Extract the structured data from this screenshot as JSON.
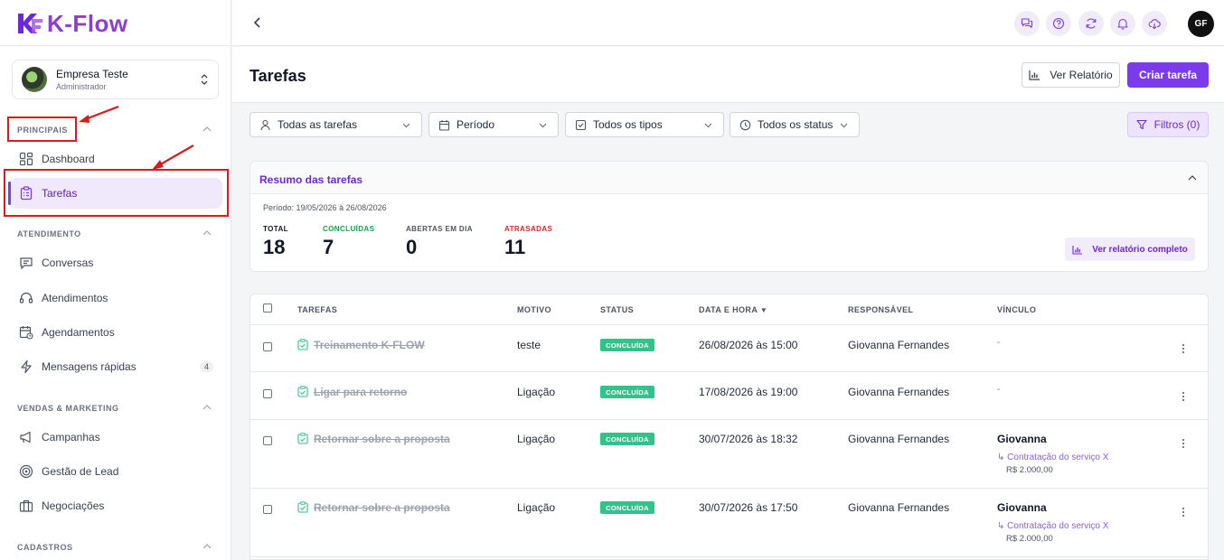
{
  "app": {
    "name": "K-Flow"
  },
  "company": {
    "name": "Empresa Teste",
    "role": "Administrador"
  },
  "sidebar": {
    "sections": [
      {
        "title": "PRINCIPAIS"
      },
      {
        "title": "ATENDIMENTO"
      },
      {
        "title": "VENDAS & MARKETING"
      },
      {
        "title": "CADASTROS"
      }
    ],
    "items": [
      {
        "label": "Dashboard",
        "icon": "grid-icon"
      },
      {
        "label": "Tarefas",
        "icon": "clipboard-icon"
      },
      {
        "label": "Conversas",
        "icon": "chat-icon"
      },
      {
        "label": "Atendimentos",
        "icon": "headset-icon"
      },
      {
        "label": "Agendamentos",
        "icon": "calendar-clock-icon"
      },
      {
        "label": "Mensagens rápidas",
        "icon": "lightning-icon",
        "badge": "4"
      },
      {
        "label": "Campanhas",
        "icon": "megaphone-icon"
      },
      {
        "label": "Gestão de Lead",
        "icon": "target-icon"
      },
      {
        "label": "Negociações",
        "icon": "briefcase-icon"
      }
    ]
  },
  "topbar": {
    "user_initials": "GF"
  },
  "header": {
    "title": "Tarefas",
    "report_label": "Ver Relatório",
    "create_label": "Criar tarefa"
  },
  "filters": {
    "tasks": "Todas as tarefas",
    "period": "Período",
    "types": "Todos os tipos",
    "status": "Todos os status",
    "filters_button": "Filtros (0)"
  },
  "summary": {
    "title": "Resumo das tarefas",
    "period": "Período: 19/05/2026 à 26/08/2026",
    "stats": [
      {
        "label": "TOTAL",
        "value": "18",
        "color": "#111827"
      },
      {
        "label": "CONCLUÍDAS",
        "value": "7",
        "color": "#16a34a"
      },
      {
        "label": "ABERTAS EM DIA",
        "value": "0",
        "color": "#4b5563"
      },
      {
        "label": "ATRASADAS",
        "value": "11",
        "color": "#dc2626"
      }
    ],
    "full_report_label": "Ver relatório completo"
  },
  "table": {
    "columns": [
      "TAREFAS",
      "MOTIVO",
      "STATUS",
      "DATA E HORA",
      "RESPONSÁVEL",
      "VÍNCULO"
    ],
    "rows": [
      {
        "task": "Treinamento K-FLOW",
        "reason": "teste",
        "status": "CONCLUÍDA",
        "datetime": "26/08/2026 às 15:00",
        "owner": "Giovanna Fernandes",
        "link": "-"
      },
      {
        "task": "Ligar para retorno",
        "reason": "Ligação",
        "status": "CONCLUÍDA",
        "datetime": "17/08/2026 às 19:00",
        "owner": "Giovanna Fernandes",
        "link": "-"
      },
      {
        "task": "Retornar sobre a proposta",
        "reason": "Ligação",
        "status": "CONCLUÍDA",
        "datetime": "30/07/2026 às 18:32",
        "owner": "Giovanna Fernandes",
        "link_title": "Giovanna",
        "link_sub": "↳ Contratação do serviço X",
        "link_price": "R$ 2.000,00"
      },
      {
        "task": "Retornar sobre a proposta",
        "reason": "Ligação",
        "status": "CONCLUÍDA",
        "datetime": "30/07/2026 às 17:50",
        "owner": "Giovanna Fernandes",
        "link_title": "Giovanna",
        "link_sub": "↳ Contratação do serviço X",
        "link_price": "R$ 2.000,00"
      }
    ]
  },
  "colors": {
    "accent": "#7c3aed",
    "success": "#34c28c",
    "danger": "#dc2626",
    "annotation": "#d61c1c"
  }
}
